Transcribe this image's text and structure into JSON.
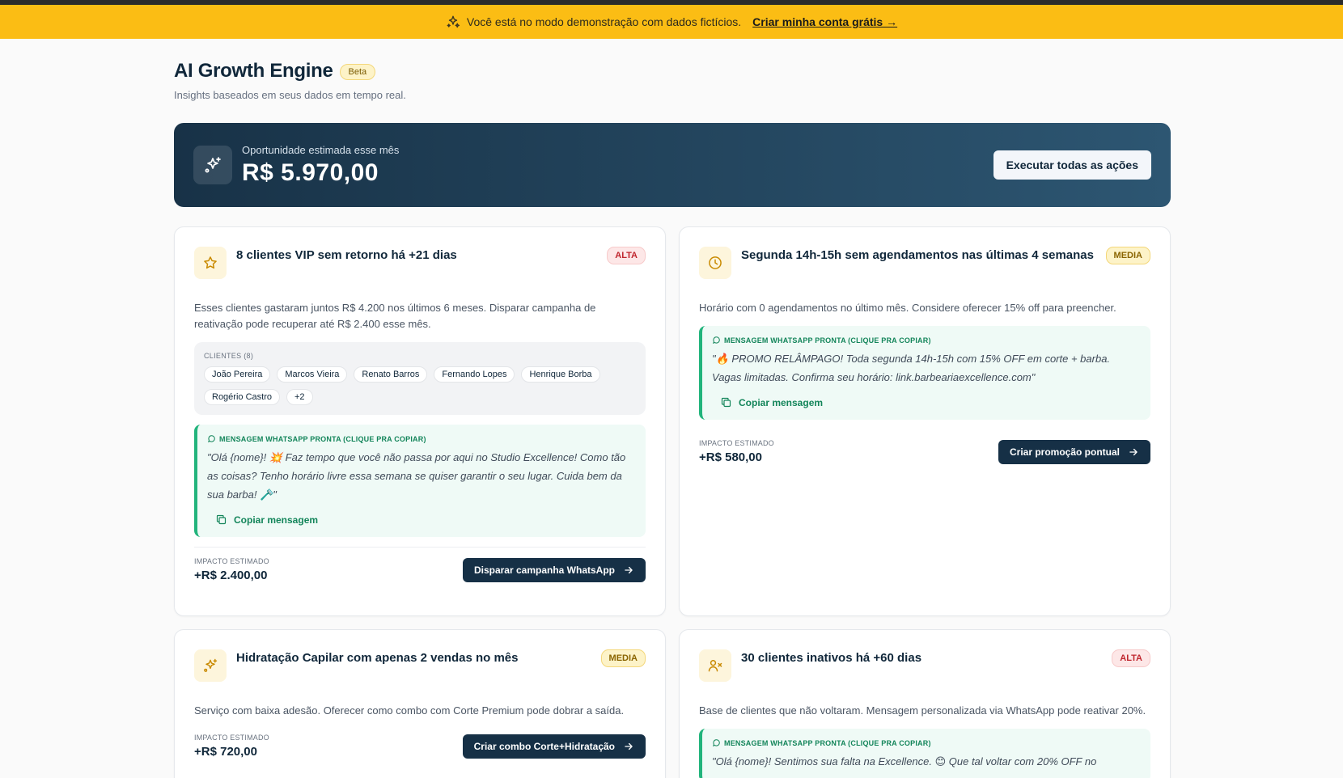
{
  "banner": {
    "text": "Você está no modo demonstração com dados fictícios.",
    "link": "Criar minha conta grátis →"
  },
  "header": {
    "title": "AI Growth Engine",
    "badge": "Beta",
    "subtitle": "Insights baseados em seus dados em tempo real."
  },
  "hero": {
    "label": "Oportunidade estimada esse mês",
    "value": "R$ 5.970,00",
    "button": "Executar todas as ações"
  },
  "cards": [
    {
      "title": "8 clientes VIP sem retorno há +21 dias",
      "priority": "ALTA",
      "description": "Esses clientes gastaram juntos R$ 4.200 nos últimos 6 meses. Disparar campanha de reativação pode recuperar até R$ 2.400 esse mês.",
      "clients_label": "CLIENTES (8)",
      "clients": [
        "João Pereira",
        "Marcos Vieira",
        "Renato Barros",
        "Fernando Lopes",
        "Henrique Borba",
        "Rogério Castro",
        "+2"
      ],
      "wa_label": "MENSAGEM WHATSAPP PRONTA (CLIQUE PRA COPIAR)",
      "wa_message": "\"Olá {nome}! 💥 Faz tempo que você não passa por aqui no Studio Excellence! Como tão as coisas? Tenho horário livre essa semana se quiser garantir o seu lugar. Cuida bem da sua barba! 🪒\"",
      "copy": "Copiar mensagem",
      "impact_label": "IMPACTO ESTIMADO",
      "impact_value": "+R$ 2.400,00",
      "action": "Disparar campanha WhatsApp"
    },
    {
      "title": "Segunda 14h-15h sem agendamentos nas últimas 4 semanas",
      "priority": "MEDIA",
      "description": "Horário com 0 agendamentos no último mês. Considere oferecer 15% off para preencher.",
      "wa_label": "MENSAGEM WHATSAPP PRONTA (CLIQUE PRA COPIAR)",
      "wa_message": "\"🔥 PROMO RELÂMPAGO! Toda segunda 14h-15h com 15% OFF em corte + barba. Vagas limitadas. Confirma seu horário: link.barbeariaexcellence.com\"",
      "copy": "Copiar mensagem",
      "impact_label": "IMPACTO ESTIMADO",
      "impact_value": "+R$ 580,00",
      "action": "Criar promoção pontual"
    },
    {
      "title": "Hidratação Capilar com apenas 2 vendas no mês",
      "priority": "MEDIA",
      "description": "Serviço com baixa adesão. Oferecer como combo com Corte Premium pode dobrar a saída.",
      "impact_label": "IMPACTO ESTIMADO",
      "impact_value": "+R$ 720,00",
      "action": "Criar combo Corte+Hidratação"
    },
    {
      "title": "30 clientes inativos há +60 dias",
      "priority": "ALTA",
      "description": "Base de clientes que não voltaram. Mensagem personalizada via WhatsApp pode reativar 20%.",
      "wa_label": "MENSAGEM WHATSAPP PRONTA (CLIQUE PRA COPIAR)",
      "wa_message": "\"Olá {nome}! Sentimos sua falta na Excellence. 😊 Que tal voltar com 20% OFF no"
    }
  ],
  "colors": {
    "banner": "#fbbd14",
    "hero_start": "#183247",
    "hero_end": "#2d5672",
    "action": "#163046",
    "whatsapp": "#22b47c"
  }
}
